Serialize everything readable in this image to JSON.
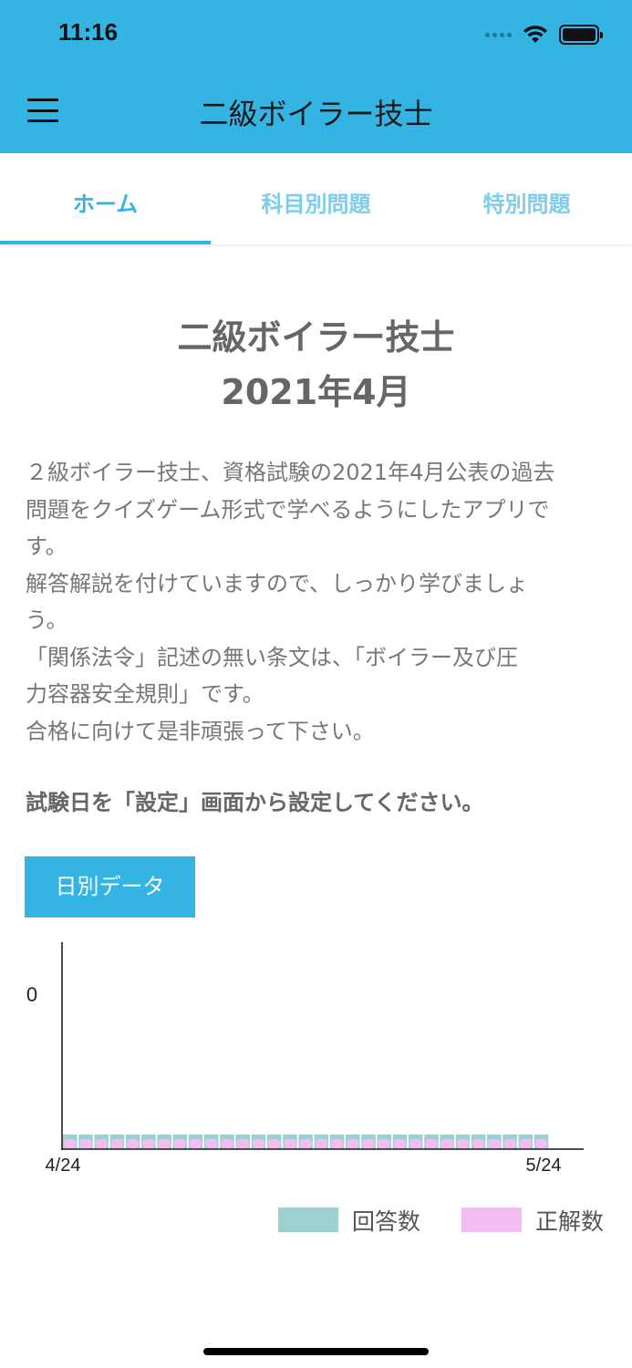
{
  "status_bar": {
    "time": "11:16",
    "icons": [
      "signal-dots-icon",
      "wifi-icon",
      "battery-icon"
    ]
  },
  "header": {
    "title": "二級ボイラー技士",
    "menu_icon": "hamburger-menu-icon",
    "background": "#33b4e3"
  },
  "tabs": [
    {
      "label": "ホーム",
      "active": true
    },
    {
      "label": "科目別問題",
      "active": false
    },
    {
      "label": "特別問題",
      "active": false
    }
  ],
  "main": {
    "title_line1": "二級ボイラー技士",
    "title_line2": "2021年4月",
    "description": [
      "２級ボイラー技士、資格試験の2021年4月公表の過去",
      "問題をクイズゲーム形式で学べるようにしたアプリで",
      "す。",
      "解答解説を付けていますので、しっかり学びましょ",
      "う。",
      "「関係法令」記述の無い条文は、「ボイラー及び圧",
      "力容器安全規則」です。",
      "合格に向けて是非頑張って下さい。"
    ],
    "notice": "試験日を「設定」画面から設定してください。",
    "daily_button_label": "日別データ"
  },
  "chart_data": {
    "type": "bar",
    "x_start_label": "4/24",
    "x_end_label": "5/24",
    "y_tick_label": "0",
    "bar_count": 31,
    "series": [
      {
        "name": "回答数",
        "color": "#9dd0cf",
        "values": [
          0,
          0,
          0,
          0,
          0,
          0,
          0,
          0,
          0,
          0,
          0,
          0,
          0,
          0,
          0,
          0,
          0,
          0,
          0,
          0,
          0,
          0,
          0,
          0,
          0,
          0,
          0,
          0,
          0,
          0,
          0
        ]
      },
      {
        "name": "正解数",
        "color": "#f2bdf3",
        "values": [
          0,
          0,
          0,
          0,
          0,
          0,
          0,
          0,
          0,
          0,
          0,
          0,
          0,
          0,
          0,
          0,
          0,
          0,
          0,
          0,
          0,
          0,
          0,
          0,
          0,
          0,
          0,
          0,
          0,
          0,
          0
        ]
      }
    ]
  },
  "home_indicator": true
}
